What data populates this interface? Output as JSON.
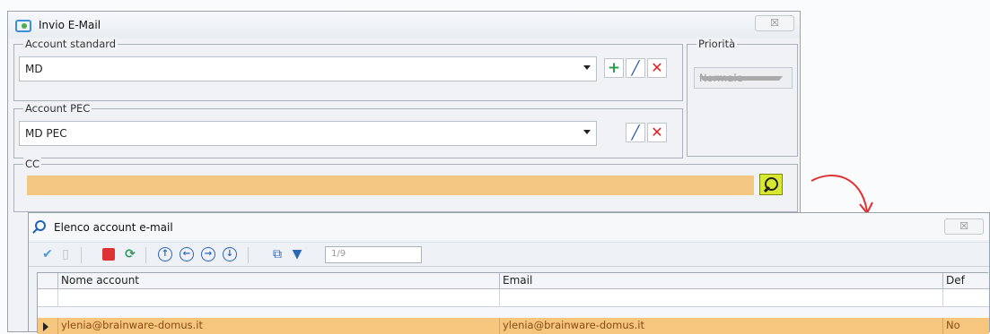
{
  "main_window": {
    "title": "Invio E-Mail",
    "close_label": "☒",
    "account_standard": {
      "legend": "Account standard",
      "value": "MD"
    },
    "priority": {
      "legend": "Priorità",
      "value": "Normale"
    },
    "account_pec": {
      "legend": "Account PEC",
      "value": "MD PEC"
    },
    "cc": {
      "legend": "CC",
      "value": ""
    }
  },
  "list_window": {
    "title": "Elenco account e-mail",
    "close_label": "☒",
    "toolbar": {
      "page_indicator": "1/9"
    },
    "grid": {
      "columns": [
        "Nome account",
        "Email",
        "Def"
      ],
      "rows": [
        {
          "nome_account": "ylenia@brainware-domus.it",
          "email": "ylenia@brainware-domus.it",
          "def": "No"
        }
      ]
    }
  },
  "colors": {
    "cc_field": "#f3c782",
    "selected_row": "#f6c57e",
    "annotation_arrow": "#e03030"
  }
}
